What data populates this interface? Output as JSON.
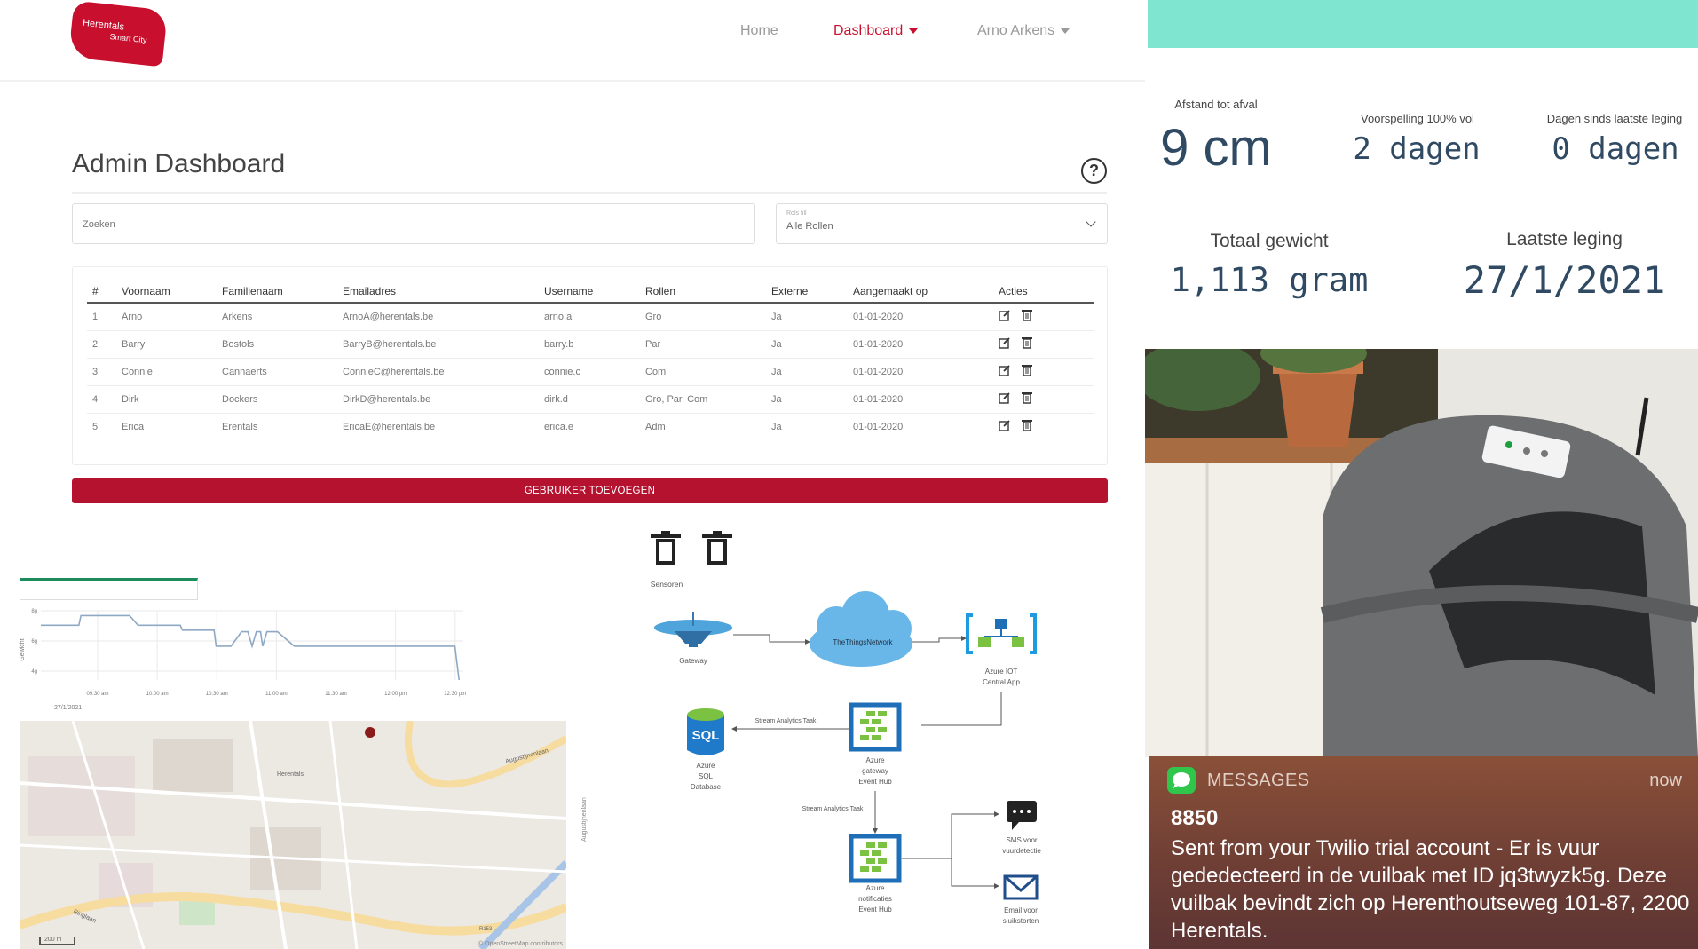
{
  "nav": {
    "logo_line1": "Herentals",
    "logo_line2": "Smart City",
    "home": "Home",
    "dashboard": "Dashboard",
    "user": "Arno Arkens"
  },
  "admin": {
    "title": "Admin Dashboard",
    "help_icon": "?",
    "search_placeholder": "Zoeken",
    "role_filter_label": "Rols fill",
    "role_filter_value": "Alle Rollen",
    "columns": [
      "#",
      "Voornaam",
      "Familienaam",
      "Emailadres",
      "Username",
      "Rollen",
      "Externe",
      "Aangemaakt op",
      "Acties"
    ],
    "rows": [
      [
        "1",
        "Arno",
        "Arkens",
        "ArnoA@herentals.be",
        "arno.a",
        "Gro",
        "Ja",
        "01-01-2020"
      ],
      [
        "2",
        "Barry",
        "Bostols",
        "BarryB@herentals.be",
        "barry.b",
        "Par",
        "Ja",
        "01-01-2020"
      ],
      [
        "3",
        "Connie",
        "Cannaerts",
        "ConnieC@herentals.be",
        "connie.c",
        "Com",
        "Ja",
        "01-01-2020"
      ],
      [
        "4",
        "Dirk",
        "Dockers",
        "DirkD@herentals.be",
        "dirk.d",
        "Gro, Par, Com",
        "Ja",
        "01-01-2020"
      ],
      [
        "5",
        "Erica",
        "Erentals",
        "EricaE@herentals.be",
        "erica.e",
        "Adm",
        "Ja",
        "01-01-2020"
      ]
    ],
    "add_button": "GEBRUIKER TOEVOEGEN"
  },
  "chart_data": {
    "type": "line",
    "title": "",
    "xlabel": "",
    "ylabel": "Gewicht",
    "x_ticks": [
      "09:30 am",
      "10:00 am",
      "10:30 am",
      "11:00 am",
      "11:30 am",
      "12:00 pm",
      "12:30 pm"
    ],
    "y_ticks": [
      "8g",
      "6g",
      "4g"
    ],
    "date_label": "27/1/2021",
    "series": [
      {
        "values": [
          [
            0.0,
            7.4
          ],
          [
            0.09,
            7.4
          ],
          [
            0.095,
            8.0
          ],
          [
            0.21,
            8.0
          ],
          [
            0.23,
            7.4
          ],
          [
            0.33,
            7.4
          ],
          [
            0.335,
            7.1
          ],
          [
            0.41,
            7.1
          ],
          [
            0.415,
            6.1
          ],
          [
            0.45,
            6.1
          ],
          [
            0.475,
            7.0
          ],
          [
            0.49,
            7.0
          ],
          [
            0.5,
            6.1
          ],
          [
            0.51,
            7.0
          ],
          [
            0.52,
            7.0
          ],
          [
            0.525,
            6.1
          ],
          [
            0.535,
            7.0
          ],
          [
            0.56,
            7.0
          ],
          [
            0.6,
            6.1
          ],
          [
            0.98,
            6.1
          ],
          [
            0.99,
            4.0
          ]
        ]
      }
    ],
    "colors": {
      "line": "#8fa9c4",
      "grid": "#eaeaea"
    }
  },
  "map": {
    "labels": [
      "Herentals",
      "Augustijnenlaan",
      "Ringlaan",
      "Augustijnenlaan",
      "R153"
    ],
    "attribution": "© OpenStreetMap contributors",
    "scale": "200 m"
  },
  "diagram": {
    "sensors_label": "Sensoren",
    "gateway": "Gateway",
    "ttn": "TheThingsNetwork",
    "iot_app": [
      "Azure IOT",
      "Central App"
    ],
    "gateway_hub": [
      "Azure",
      "gateway",
      "Event Hub"
    ],
    "sql": [
      "Azure",
      "SQL",
      "Database"
    ],
    "sql_badge": "SQL",
    "stream_task_1": "Stream Analytics Taak",
    "stream_task_2": "Stream Analytics Taak",
    "notif_hub": [
      "Azure",
      "notificaties",
      "Event Hub"
    ],
    "sms": [
      "SMS voor",
      "vuurdetectie"
    ],
    "email": [
      "Email voor",
      "sluikstorten"
    ]
  },
  "metrics": {
    "distance_label": "Afstand tot afval",
    "distance_value": "9 cm",
    "forecast_label": "Voorspelling 100% vol",
    "forecast_value": "2 dagen",
    "days_label": "Dagen sinds laatste leging",
    "days_value": "0 dagen",
    "weight_label": "Totaal gewicht",
    "weight_value": "1,113 gram",
    "last_label": "Laatste leging",
    "last_value": "27/1/2021"
  },
  "notification": {
    "app": "MESSAGES",
    "time": "now",
    "sender": "8850",
    "body": "Sent from your Twilio trial account - Er is vuur gededecteerd in de vuilbak met ID jq3twyzk5g. Deze vuilbak bevindt zich op Herenthoutseweg 101-87, 2200 Herentals."
  }
}
